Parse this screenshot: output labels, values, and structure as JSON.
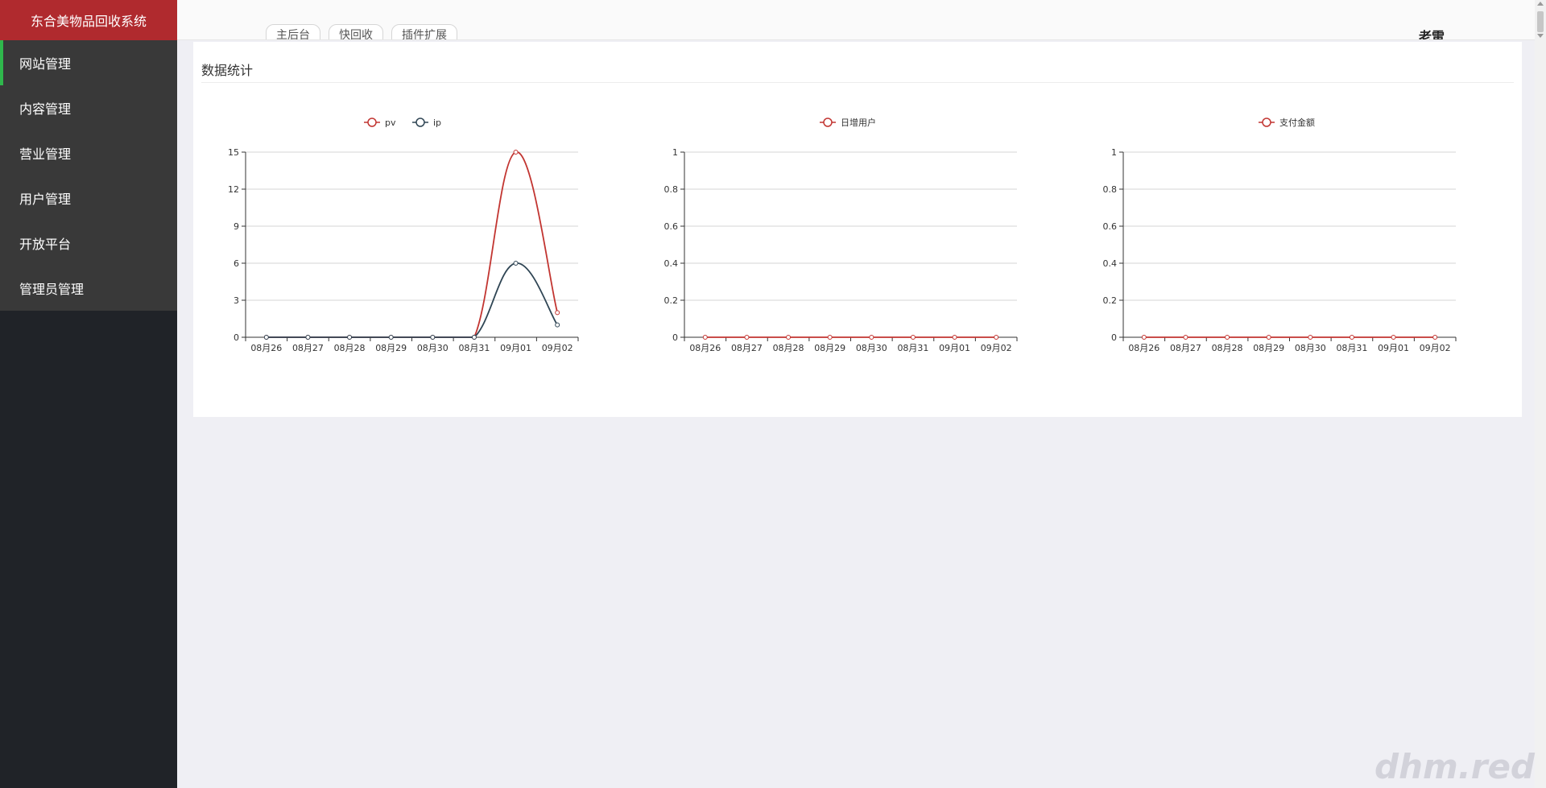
{
  "app": {
    "title": "东合美物品回收系统"
  },
  "sidebar": {
    "items": [
      {
        "label": "网站管理",
        "name": "sidebar-item-website",
        "active": true
      },
      {
        "label": "内容管理",
        "name": "sidebar-item-content"
      },
      {
        "label": "营业管理",
        "name": "sidebar-item-business"
      },
      {
        "label": "用户管理",
        "name": "sidebar-item-users"
      },
      {
        "label": "开放平台",
        "name": "sidebar-item-open-platform"
      },
      {
        "label": "管理员管理",
        "name": "sidebar-item-admins"
      }
    ]
  },
  "topbar": {
    "tabs": [
      "主后台",
      "快回收",
      "插件扩展"
    ],
    "user": "老雷"
  },
  "panel": {
    "title": "数据统计"
  },
  "colors": {
    "pv": "#c23531",
    "ip": "#2f4554",
    "brand": "#b02a2e",
    "accent": "#2fb74c"
  },
  "chart_data": [
    {
      "type": "line",
      "categories": [
        "08月26",
        "08月27",
        "08月28",
        "08月29",
        "08月30",
        "08月31",
        "09月01",
        "09月02"
      ],
      "series": [
        {
          "name": "pv",
          "values": [
            0,
            0,
            0,
            0,
            0,
            0,
            15,
            2
          ]
        },
        {
          "name": "ip",
          "values": [
            0,
            0,
            0,
            0,
            0,
            0,
            6,
            1
          ]
        }
      ],
      "ylim": [
        0,
        15
      ],
      "yticks": [
        "0",
        "3",
        "6",
        "9",
        "12",
        "15"
      ],
      "legend": "top-center",
      "grid": true
    },
    {
      "type": "line",
      "categories": [
        "08月26",
        "08月27",
        "08月28",
        "08月29",
        "08月30",
        "08月31",
        "09月01",
        "09月02"
      ],
      "series": [
        {
          "name": "日增用户",
          "values": [
            0,
            0,
            0,
            0,
            0,
            0,
            0,
            0
          ]
        }
      ],
      "ylim": [
        0,
        1
      ],
      "yticks": [
        "0",
        "0.2",
        "0.4",
        "0.6",
        "0.8",
        "1"
      ],
      "legend": "top-center",
      "grid": true
    },
    {
      "type": "line",
      "categories": [
        "08月26",
        "08月27",
        "08月28",
        "08月29",
        "08月30",
        "08月31",
        "09月01",
        "09月02"
      ],
      "series": [
        {
          "name": "支付金额",
          "values": [
            0,
            0,
            0,
            0,
            0,
            0,
            0,
            0
          ]
        }
      ],
      "ylim": [
        0,
        1
      ],
      "yticks": [
        "0",
        "0.2",
        "0.4",
        "0.6",
        "0.8",
        "1"
      ],
      "legend": "top-center",
      "grid": true
    }
  ],
  "watermark": "dhm.red"
}
